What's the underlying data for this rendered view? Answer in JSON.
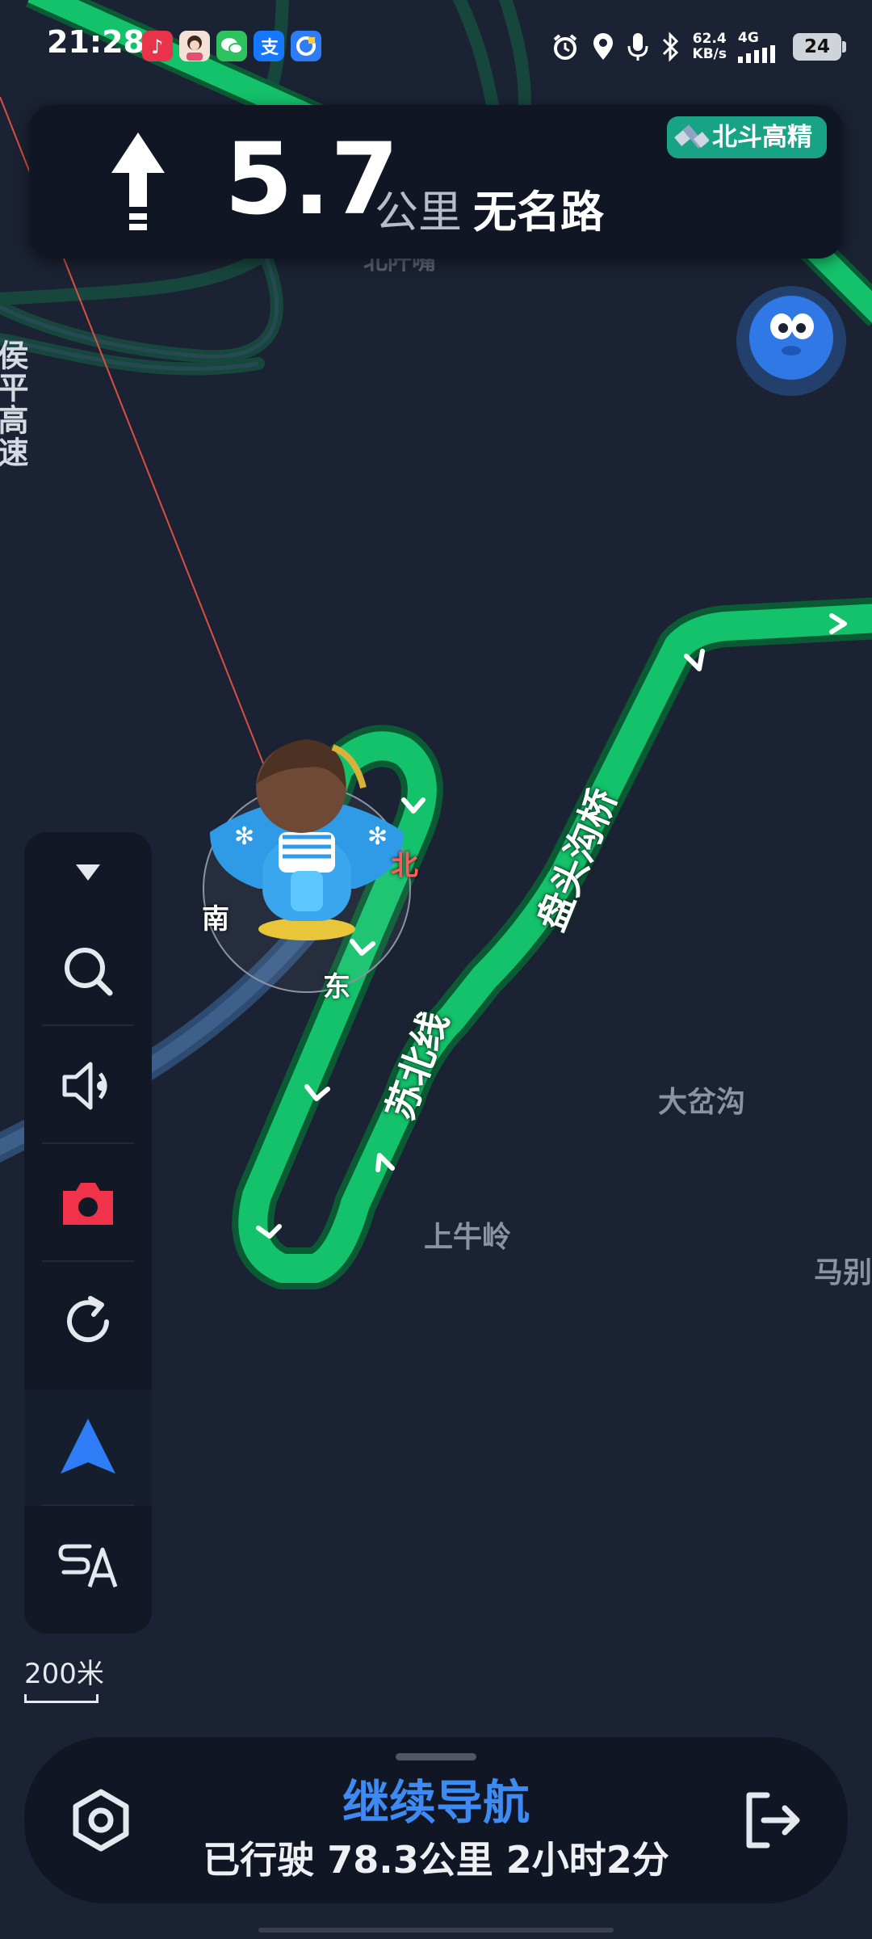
{
  "status_bar": {
    "time": "21:28",
    "speed_value": "62.4",
    "speed_unit": "KB/s",
    "network": "4G",
    "battery": "24",
    "apps": [
      "douyin-icon",
      "avatar-app-icon",
      "wechat-icon",
      "alipay-icon",
      "browser-app-icon"
    ],
    "indicators": [
      "alarm-icon",
      "location-icon",
      "microphone-icon",
      "bluetooth-icon",
      "signal-icon"
    ]
  },
  "instruction": {
    "distance": "5.7",
    "unit": "公里",
    "road": "无名路",
    "maneuver_icon": "straight-arrow-icon"
  },
  "beidou_badge": "北斗高精",
  "map": {
    "labels": {
      "highway_vertical": "侯平高速",
      "hidden_top_label": "北阡嘴",
      "dacha": "大岔沟",
      "shangniuling": "上牛岭",
      "mabie": "马别"
    },
    "road_labels": {
      "panto_bridge": "盘头沟桥",
      "subei_line": "苏北线"
    },
    "compass": {
      "north": "北",
      "south": "南",
      "east": "东"
    },
    "route_color": "#13c26b",
    "route_border": "#0a5b34",
    "background_color": "#1b2233"
  },
  "toolbar": {
    "collapse": "chevron-down-icon",
    "items": [
      "search-icon",
      "volume-icon",
      "camera-icon",
      "refresh-icon",
      "navigation-arrow-icon",
      "route-overview-icon"
    ]
  },
  "scale": "200米",
  "bottom": {
    "continue": "继续导航",
    "trip_info": "已行驶 78.3公里 2小时2分",
    "settings_icon": "hexagon-settings-icon",
    "exit_icon": "exit-icon"
  }
}
